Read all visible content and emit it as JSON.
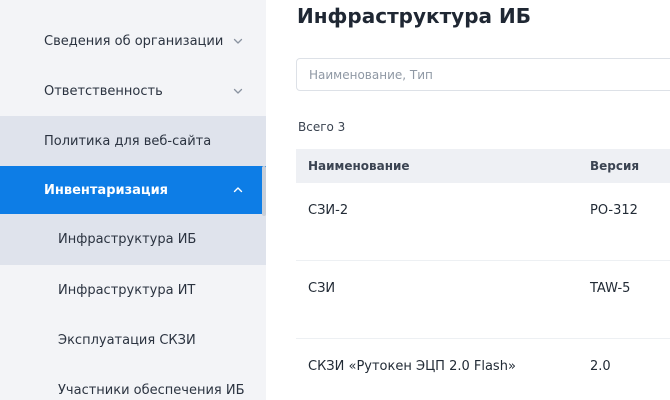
{
  "sidebar": {
    "items": [
      {
        "label": "Сведения об организации",
        "icon": "chevron-down-icon"
      },
      {
        "label": "Ответственность",
        "icon": "chevron-down-icon"
      },
      {
        "label": "Политика для веб-сайта"
      },
      {
        "label": "Инвентаризация",
        "icon": "chevron-up-icon",
        "active": true
      },
      {
        "label": "Инфраструктура ИБ",
        "selected": true
      },
      {
        "label": "Инфраструктура ИТ"
      },
      {
        "label": "Эксплуатация СКЗИ"
      },
      {
        "label": "Участники обеспечения ИБ"
      }
    ]
  },
  "main": {
    "title": "Инфраструктура ИБ",
    "search": {
      "placeholder": "Наименование, Тип",
      "value": ""
    },
    "total": "Всего 3",
    "table": {
      "columns": [
        "Наименование",
        "Версия"
      ],
      "rows": [
        [
          "СЗИ-2",
          "PO-312"
        ],
        [
          "СЗИ",
          "TAW-5"
        ],
        [
          "СКЗИ «Рутокен ЭЦП 2.0 Flash»",
          "2.0"
        ]
      ]
    }
  },
  "colors": {
    "accent": "#0d7de6",
    "sidebar_bg": "#f3f4f7",
    "sidebar_selected": "#dfe3ec",
    "table_header_bg": "#eef0f4"
  }
}
